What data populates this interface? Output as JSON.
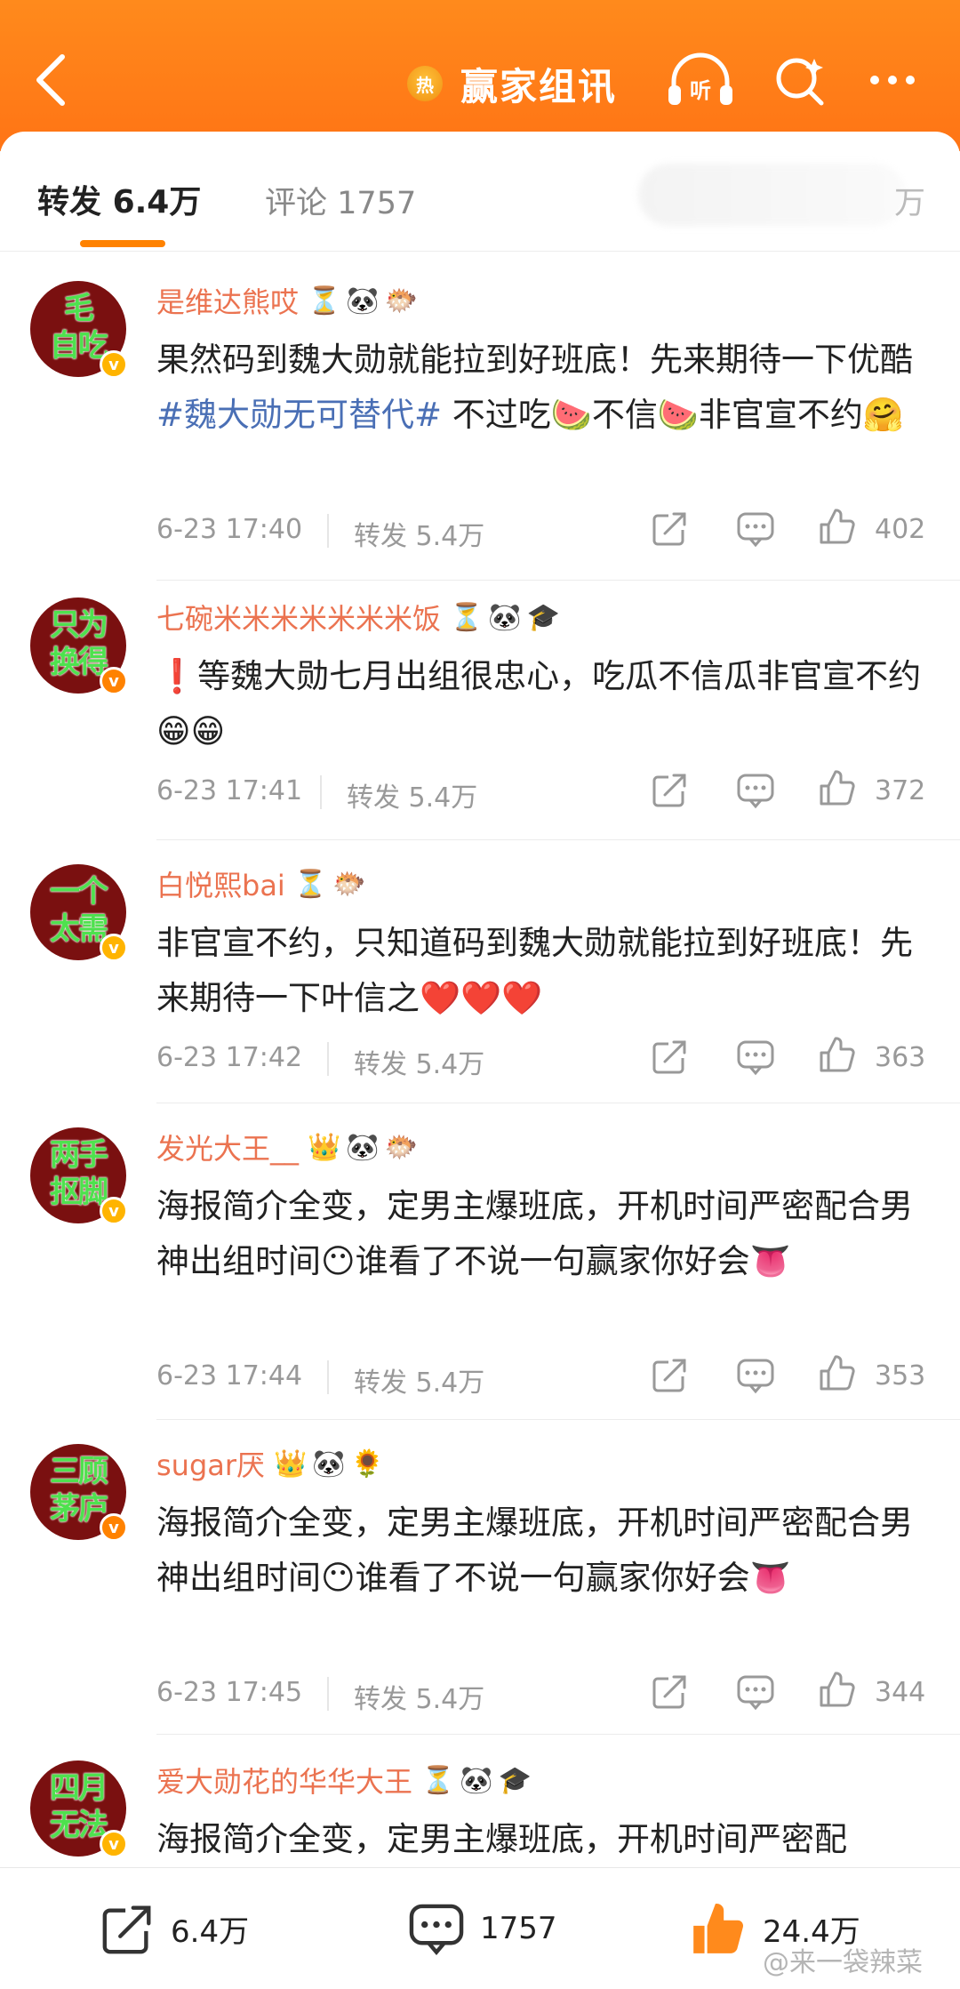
{
  "header": {
    "title": "赢家组讯",
    "hot_icon_label": "热"
  },
  "tabs": {
    "repost_label": "转发",
    "repost_count": "6.4万",
    "comment_label": "评论",
    "comment_count": "1757",
    "like_tail": "万"
  },
  "posts": [
    {
      "avatar_line1": "毛",
      "avatar_line2": "自吃",
      "username": "是维达熊哎",
      "badges": [
        "⏳",
        "🐼",
        "🐡"
      ],
      "content_before": "果然码到魏大勋就能拉到好班底！先来期待一下优酷",
      "hashtag": "#魏大勋无可替代#",
      "content_after": " 不过吃🍉不信🍉非官宣不约🤗",
      "time": "6-23 17:40",
      "repost_label": "转发",
      "repost_count": "5.4万",
      "likes": "402"
    },
    {
      "avatar_line1": "只为",
      "avatar_line2": "换得",
      "username": "七碗米米米米米米米饭",
      "badges": [
        "⏳",
        "🐼",
        "🎓"
      ],
      "content_before": "❗等魏大勋七月出组很忠心，吃瓜不信瓜非官宣不约😁😁",
      "hashtag": "",
      "content_after": "",
      "time": "6-23 17:41",
      "repost_label": "转发",
      "repost_count": "5.4万",
      "likes": "372"
    },
    {
      "avatar_line1": "一个",
      "avatar_line2": "太需",
      "username": "白悦熙bai",
      "badges": [
        "⏳",
        "🐡"
      ],
      "content_before": "非官宣不约，只知道码到魏大勋就能拉到好班底！先来期待一下叶信之❤️❤️❤️",
      "hashtag": "",
      "content_after": "",
      "time": "6-23 17:42",
      "repost_label": "转发",
      "repost_count": "5.4万",
      "likes": "363"
    },
    {
      "avatar_line1": "两手",
      "avatar_line2": "抠脚",
      "username": "发光大王__",
      "badges": [
        "👑",
        "🐼",
        "🐡"
      ],
      "content_before": "海报简介全变，定男主爆班底，开机时间严密配合男神出组时间😶谁看了不说一句赢家你好会👅",
      "hashtag": "",
      "content_after": "",
      "time": "6-23 17:44",
      "repost_label": "转发",
      "repost_count": "5.4万",
      "likes": "353"
    },
    {
      "avatar_line1": "三顾",
      "avatar_line2": "茅庐",
      "username": "sugar厌",
      "badges": [
        "👑",
        "🐼",
        "🌻"
      ],
      "content_before": "海报简介全变，定男主爆班底，开机时间严密配合男神出组时间😶谁看了不说一句赢家你好会👅",
      "hashtag": "",
      "content_after": "",
      "time": "6-23 17:45",
      "repost_label": "转发",
      "repost_count": "5.4万",
      "likes": "344"
    },
    {
      "avatar_line1": "四月",
      "avatar_line2": "无法",
      "username": "爱大勋花的华华大王",
      "badges": [
        "⏳",
        "🐼",
        "🎓"
      ],
      "content_before": "海报简介全变，定男主爆班底，开机时间严密配",
      "hashtag": "",
      "content_after": "",
      "time": "",
      "repost_label": "",
      "repost_count": "",
      "likes": ""
    }
  ],
  "bottom_bar": {
    "repost_count": "6.4万",
    "comment_count": "1757",
    "like_count": "24.4万"
  },
  "watermark": "@来一袋辣菜",
  "colors": {
    "accent": "#ff8200",
    "username": "#eb7350",
    "hashtag": "#4a6fb5"
  }
}
